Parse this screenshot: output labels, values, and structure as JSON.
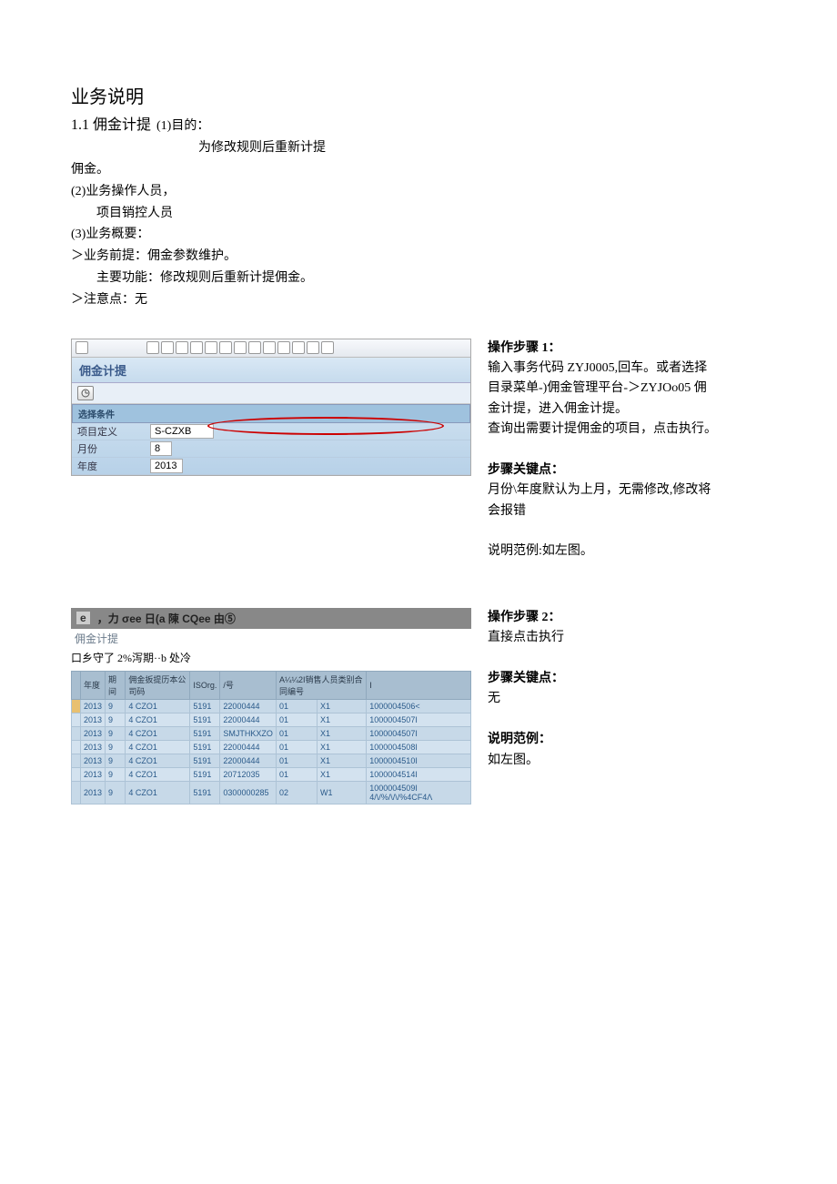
{
  "intro": {
    "businessDesc": "业务说明",
    "section": "1.1 佣金计提",
    "purposeLabel": "(1)目的：",
    "purposeText": "为修改规则后重新计提",
    "commissionEnd": "佣金。",
    "operatorsLabel": "(2)业务操作人员，",
    "operatorsText": "项目销控人员",
    "overviewLabel": "(3)业务概要：",
    "pre": "＞业务前提：佣金参数维护。",
    "main": "主要功能：修改规则后重新计提佣金。",
    "note": "＞注意点：无"
  },
  "shot1": {
    "title": "佣金计提",
    "condHeader": "选择条件",
    "f1Label": "项目定义",
    "f1Value": "S-CZXB",
    "f2Label": "月份",
    "f2Value": "8",
    "f3Label": "年度",
    "f3Value": "2013"
  },
  "side1": {
    "stepTitle": "操作步骤 1：",
    "l1": "输入事务代码 ZYJ0005,回车。或者选择",
    "l2": "目录菜单-)佣金管理平台-＞ZYJOo05 佣",
    "l3": "金计提，进入佣金计提。",
    "l4": "查询出需要计提佣金的项目，点击执行。",
    "keyTitle": "步骤关键点：",
    "key1": "月份\\年度默认为上月，无需修改,修改将",
    "key2": "会报错",
    "exTitle": "说明范例:如左图。"
  },
  "shot2": {
    "barPrefix": "e",
    "barText": "，力 σee 日(a 陳 CQee 由⑤",
    "title": "佣金计提",
    "sub": "口乡守了 2%泻期··b 处冷",
    "headers": [
      "",
      "年度",
      "期间",
      "佣金扳提历本公司码",
      "ISOrg.",
      "/号",
      "A¼¼2I销售人员类别合同编号",
      "",
      ""
    ]
  },
  "tableRows": [
    {
      "year": "2013",
      "period": "9",
      "rest": "4 CZO1",
      "iso": "5191",
      "no": "22000444",
      "c": "01",
      "cls": "X1",
      "ctr": "1000004506<"
    },
    {
      "year": "2013",
      "period": "9",
      "rest": "4 CZO1",
      "iso": "5191",
      "no": "22000444",
      "c": "01",
      "cls": "X1",
      "ctr": "1000004507I"
    },
    {
      "year": "2013",
      "period": "9",
      "rest": "4 CZO1",
      "iso": "5191",
      "no": "SMJTHKXZO",
      "c": "01",
      "cls": "X1",
      "ctr": "1000004507I"
    },
    {
      "year": "2013",
      "period": "9",
      "rest": "4 CZO1",
      "iso": "5191",
      "no": "22000444",
      "c": "01",
      "cls": "X1",
      "ctr": "1000004508I"
    },
    {
      "year": "2013",
      "period": "9",
      "rest": "4 CZO1",
      "iso": "5191",
      "no": "22000444",
      "c": "01",
      "cls": "X1",
      "ctr": "1000004510I"
    },
    {
      "year": "2013",
      "period": "9",
      "rest": "4 CZO1",
      "iso": "5191",
      "no": "20712035",
      "c": "01",
      "cls": "X1",
      "ctr": "1000004514I"
    },
    {
      "year": "2013",
      "period": "9",
      "rest": "4 CZO1",
      "iso": "5191",
      "no": "0300000285",
      "c": "02",
      "cls": "W1",
      "ctr": "1000004509I 4/\\/%/\\/\\/%4CF4Λ"
    }
  ],
  "side2": {
    "stepTitle": "操作步骤 2：",
    "l1": "直接点击执行",
    "keyTitle": "步骤关键点：",
    "key1": "无",
    "exTitle": "说明范例：",
    "ex1": "如左图。"
  }
}
